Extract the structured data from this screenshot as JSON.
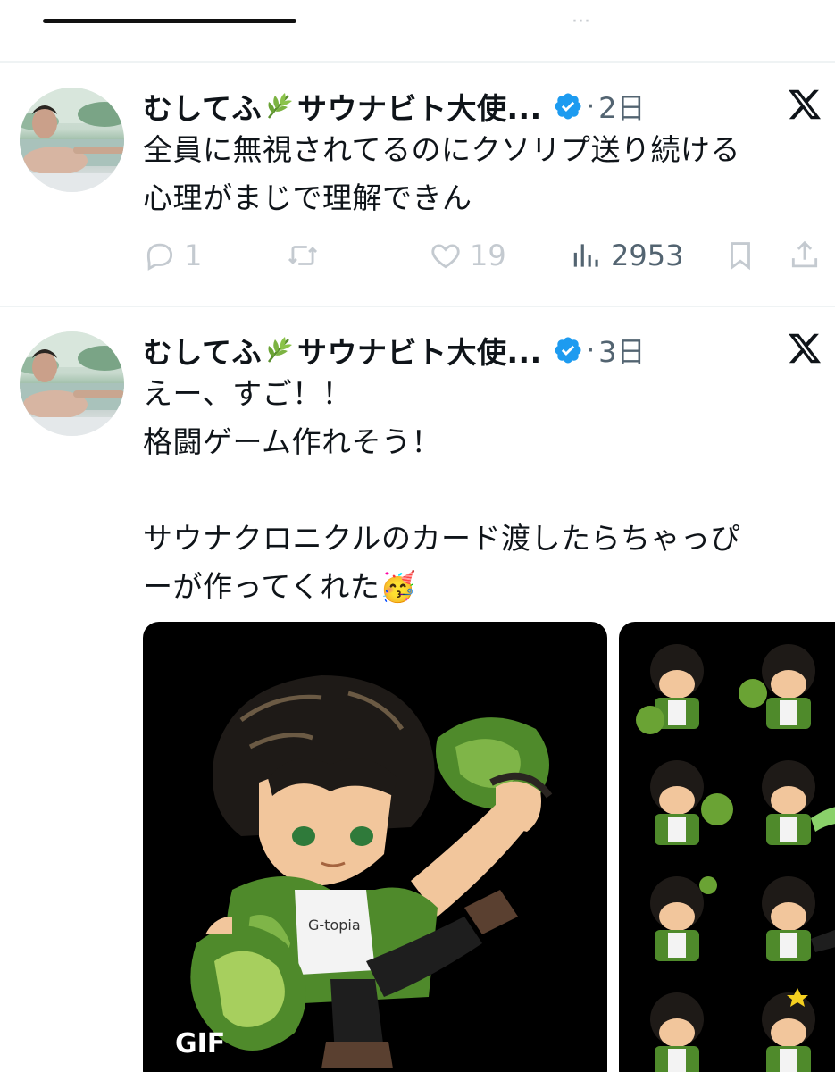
{
  "tweets": [
    {
      "author_name": "むしてふ",
      "author_suffix": "サウナビト大使...",
      "separator": "·",
      "time": "2日",
      "lines": [
        "全員に無視されてるのにクソリプ送り続ける",
        "心理がまじで理解できん"
      ],
      "replies": "1",
      "retweets": "",
      "likes": "19",
      "views": "2953"
    },
    {
      "author_name": "むしてふ",
      "author_suffix": "サウナビト大使...",
      "separator": "·",
      "time": "3日",
      "lines": [
        "えー、すご！！",
        "格闘ゲーム作れそう！",
        "",
        "サウナクロニクルのカード渡したらちゃっぴ",
        "ーが作ってくれた🥳"
      ],
      "media_badge": "GIF"
    }
  ],
  "colors": {
    "verified": "#1d9bf0",
    "text": "#0f1419",
    "secondary": "#536471",
    "muted_action": "#c4cad0",
    "divider": "#eff3f4"
  },
  "icons": [
    "leaf-icon",
    "verified-icon",
    "x-logo-icon",
    "reply-icon",
    "retweet-icon",
    "like-icon",
    "views-icon",
    "bookmark-icon",
    "share-icon"
  ]
}
